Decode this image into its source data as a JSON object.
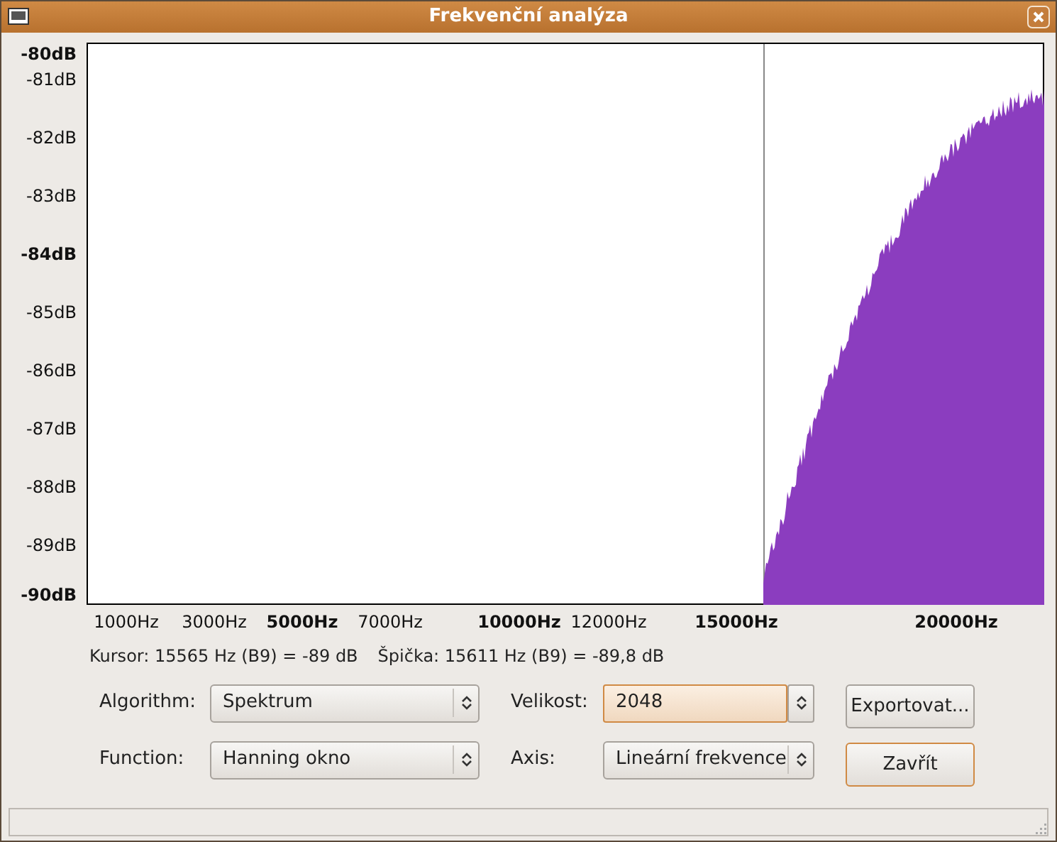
{
  "window": {
    "title": "Frekvenční analýza"
  },
  "plot": {
    "y_labels": [
      {
        "text": "-80dB",
        "bold": true
      },
      {
        "text": "-81dB",
        "bold": false
      },
      {
        "text": "-82dB",
        "bold": false
      },
      {
        "text": "-83dB",
        "bold": false
      },
      {
        "text": "-84dB",
        "bold": true
      },
      {
        "text": "-85dB",
        "bold": false
      },
      {
        "text": "-86dB",
        "bold": false
      },
      {
        "text": "-87dB",
        "bold": false
      },
      {
        "text": "-88dB",
        "bold": false
      },
      {
        "text": "-89dB",
        "bold": false
      },
      {
        "text": "-90dB",
        "bold": true
      }
    ],
    "x_labels": [
      {
        "text": "1000Hz",
        "bold": false
      },
      {
        "text": "3000Hz",
        "bold": false
      },
      {
        "text": "5000Hz",
        "bold": true
      },
      {
        "text": "7000Hz",
        "bold": false
      },
      {
        "text": "10000Hz",
        "bold": true
      },
      {
        "text": "12000Hz",
        "bold": false
      },
      {
        "text": "15000Hz",
        "bold": true
      },
      {
        "text": "20000Hz",
        "bold": true
      }
    ]
  },
  "readout": {
    "cursor": "Kursor: 15565 Hz (B9) = -89 dB",
    "peak": "Špička: 15611 Hz (B9) = -89,8 dB"
  },
  "controls": [
    {
      "label": "Algorithm:",
      "kind": "combo",
      "value": "Spektrum",
      "focused": false
    },
    {
      "label": "Velikost:",
      "kind": "spin",
      "value": "2048",
      "focused": true
    },
    {
      "label": "Function:",
      "kind": "combo",
      "value": "Hanning okno",
      "focused": false
    },
    {
      "label": "Axis:",
      "kind": "combo",
      "value": "Lineární frekvence",
      "focused": false
    }
  ],
  "buttons": [
    {
      "label": "Exportovat...",
      "default": false
    },
    {
      "label": "Zavřít",
      "default": true
    }
  ]
}
